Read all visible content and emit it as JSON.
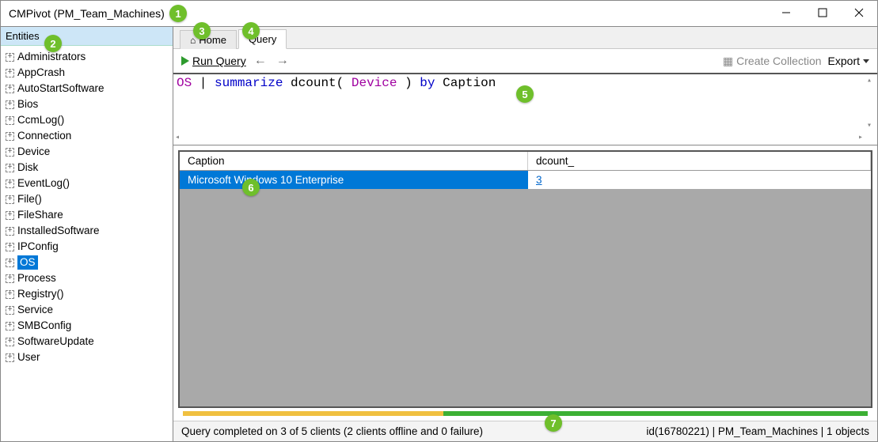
{
  "window": {
    "title": "CMPivot (PM_Team_Machines)"
  },
  "sidebar": {
    "header": "Entities",
    "items": [
      {
        "label": "Administrators"
      },
      {
        "label": "AppCrash"
      },
      {
        "label": "AutoStartSoftware"
      },
      {
        "label": "Bios"
      },
      {
        "label": "CcmLog()"
      },
      {
        "label": "Connection"
      },
      {
        "label": "Device"
      },
      {
        "label": "Disk"
      },
      {
        "label": "EventLog()"
      },
      {
        "label": "File()"
      },
      {
        "label": "FileShare"
      },
      {
        "label": "InstalledSoftware"
      },
      {
        "label": "IPConfig"
      },
      {
        "label": "OS",
        "selected": true
      },
      {
        "label": "Process"
      },
      {
        "label": "Registry()"
      },
      {
        "label": "Service"
      },
      {
        "label": "SMBConfig"
      },
      {
        "label": "SoftwareUpdate"
      },
      {
        "label": "User"
      }
    ]
  },
  "tabs": {
    "home": "Home",
    "query": "Query"
  },
  "toolbar": {
    "run": "Run Query",
    "create_collection": "Create Collection",
    "export": "Export"
  },
  "query": {
    "tok_entity": "OS",
    "tok_pipe": " | ",
    "tok_summarize": "summarize",
    "tok_sp1": " ",
    "tok_dcount": "dcount(",
    "tok_sp2": " ",
    "tok_device": "Device",
    "tok_sp3": " ",
    "tok_close": ")",
    "tok_by": " by ",
    "tok_caption": "Caption"
  },
  "results": {
    "columns": {
      "c1": "Caption",
      "c2": "dcount_"
    },
    "rows": [
      {
        "c1": "Microsoft Windows 10 Enterprise",
        "c2": "3"
      }
    ]
  },
  "status": {
    "left": "Query completed on 3 of 5 clients (2 clients offline and 0 failure)",
    "right": "id(16780221)  |  PM_Team_Machines  |  1 objects"
  },
  "callouts": {
    "1": "1",
    "2": "2",
    "3": "3",
    "4": "4",
    "5": "5",
    "6": "6",
    "7": "7"
  }
}
